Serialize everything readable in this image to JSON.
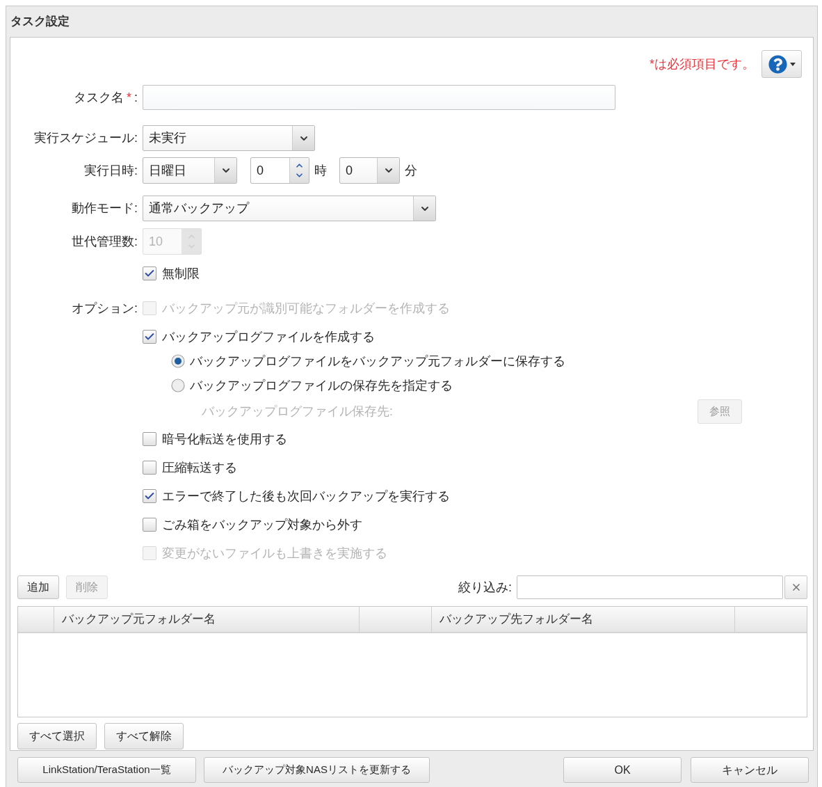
{
  "window": {
    "title": "タスク設定"
  },
  "required_note": "*は必須項目です。",
  "task_name": {
    "label": "タスク名",
    "required_mark": "*",
    "suffix": ":"
  },
  "schedule": {
    "label": "実行スケジュール:",
    "value": "未実行"
  },
  "run_time": {
    "label": "実行日時:",
    "day": "日曜日",
    "hour": "0",
    "hour_unit": "時",
    "minute": "0",
    "minute_unit": "分"
  },
  "mode": {
    "label": "動作モード:",
    "value": "通常バックアップ"
  },
  "generations": {
    "label": "世代管理数:",
    "value": "10",
    "disabled": true
  },
  "unlimited": {
    "label": "無制限",
    "checked": true
  },
  "options": {
    "label": "オプション:",
    "items": [
      {
        "kind": "checkbox",
        "label": "バックアップ元が識別可能なフォルダーを作成する",
        "checked": false,
        "disabled": true
      },
      {
        "kind": "checkbox",
        "label": "バックアップログファイルを作成する",
        "checked": true,
        "disabled": false,
        "children": [
          {
            "kind": "radio",
            "label": "バックアップログファイルをバックアップ元フォルダーに保存する",
            "selected": true,
            "disabled": false
          },
          {
            "kind": "radio",
            "label": "バックアップログファイルの保存先を指定する",
            "selected": false,
            "disabled": false
          },
          {
            "kind": "path",
            "label": "バックアップログファイル保存先:",
            "disabled": true,
            "button": {
              "label": "参照",
              "disabled": true
            }
          }
        ]
      },
      {
        "kind": "checkbox",
        "label": "暗号化転送を使用する",
        "checked": false,
        "disabled": false
      },
      {
        "kind": "checkbox",
        "label": "圧縮転送する",
        "checked": false,
        "disabled": false
      },
      {
        "kind": "checkbox",
        "label": "エラーで終了した後も次回バックアップを実行する",
        "checked": true,
        "disabled": false
      },
      {
        "kind": "checkbox",
        "label": "ごみ箱をバックアップ対象から外す",
        "checked": false,
        "disabled": false
      },
      {
        "kind": "checkbox",
        "label": "変更がないファイルも上書きを実施する",
        "checked": false,
        "disabled": true
      }
    ]
  },
  "toolbar": {
    "buttons": [
      {
        "label": "追加",
        "disabled": false
      },
      {
        "label": "削除",
        "disabled": true
      }
    ],
    "filter": {
      "label": "絞り込み:"
    }
  },
  "table": {
    "columns": [
      {
        "kind": "blank"
      },
      {
        "kind": "text",
        "label": "バックアップ元フォルダー名"
      },
      {
        "kind": "blank"
      },
      {
        "kind": "text",
        "label": "バックアップ先フォルダー名"
      },
      {
        "kind": "blank"
      }
    ]
  },
  "selection_buttons": [
    "すべて選択",
    "すべて解除"
  ],
  "footer": {
    "left_buttons": [
      "LinkStation/TeraStation一覧",
      "バックアップ対象NASリストを更新する"
    ],
    "right_buttons": [
      "OK",
      "キャンセル"
    ]
  }
}
